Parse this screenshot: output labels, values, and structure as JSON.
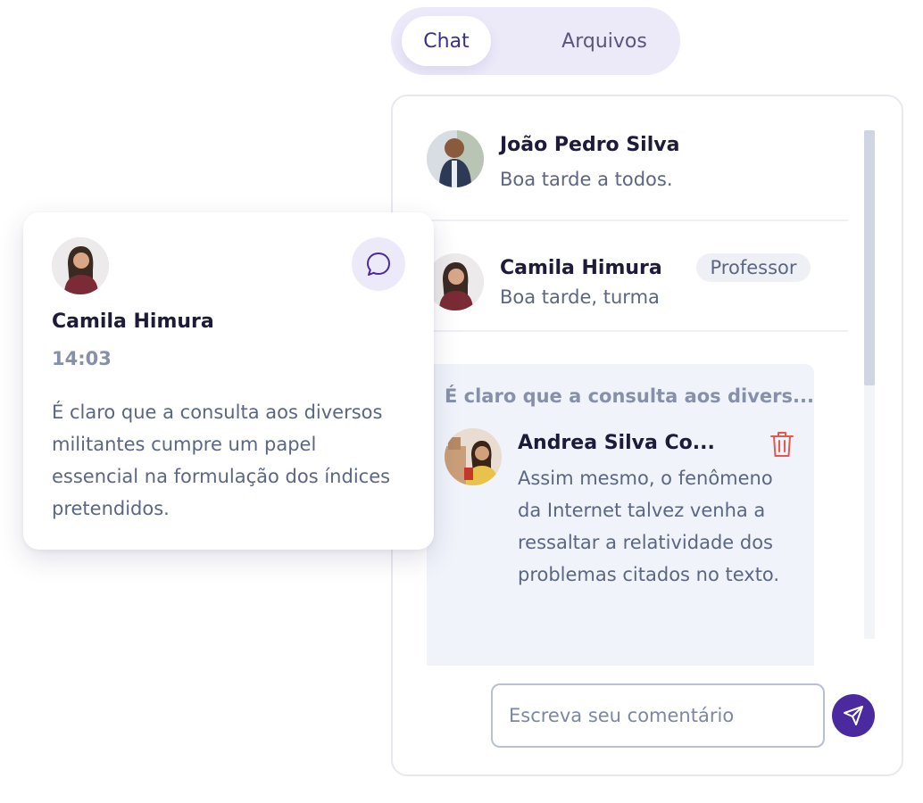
{
  "tabs": [
    {
      "label": "Chat",
      "active": true
    },
    {
      "label": "Arquivos",
      "active": false
    }
  ],
  "chat": {
    "messages": [
      {
        "author": "João Pedro Silva",
        "text": "Boa tarde a todos."
      },
      {
        "author": "Camila Himura",
        "badge": "Professor",
        "text": "Boa tarde, turma"
      }
    ],
    "thread": {
      "quoted": "É claro que a consulta aos divers...",
      "reply": {
        "author": "Andrea Silva Co...",
        "text": "Assim mesmo, o fenômeno da Internet talvez venha a ressaltar a relatividade dos problemas citados no texto."
      }
    },
    "input": {
      "placeholder": "Escreva seu comentário",
      "value": ""
    }
  },
  "card": {
    "author": "Camila Himura",
    "time": "14:03",
    "text": "É claro que a consulta aos diversos militantes cumpre um papel essencial na formulação dos índices pretendidos."
  },
  "icons": {
    "chat": "chat-bubble-icon",
    "delete": "trash-icon",
    "send": "send-icon"
  },
  "colors": {
    "accent": "#4b2aa0",
    "danger": "#e5584f",
    "tab_background": "#ece9f9",
    "thread_background": "#f0f3fa"
  }
}
